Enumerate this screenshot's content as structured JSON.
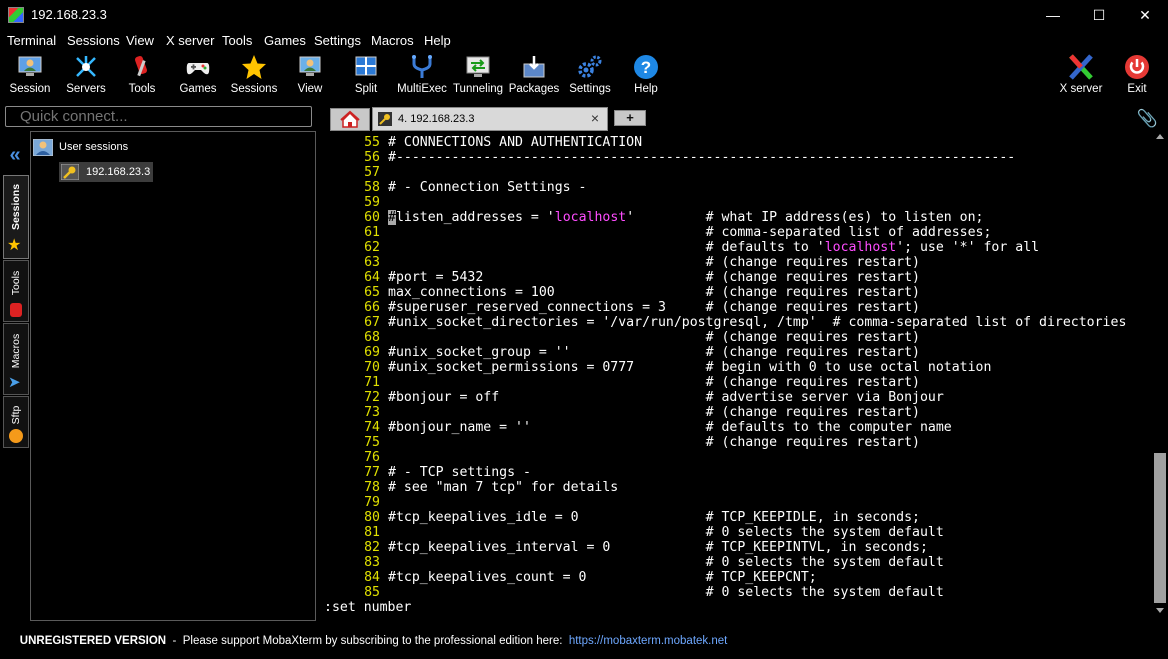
{
  "window": {
    "title": "192.168.23.3",
    "minimize": "—",
    "maximize": "☐",
    "close": "✕"
  },
  "menu": [
    "Terminal",
    "Sessions",
    "View",
    "X server",
    "Tools",
    "Games",
    "Settings",
    "Macros",
    "Help"
  ],
  "toolbar": {
    "items": [
      {
        "label": "Session",
        "icon": "session-icon"
      },
      {
        "label": "Servers",
        "icon": "servers-icon"
      },
      {
        "label": "Tools",
        "icon": "tools-icon"
      },
      {
        "label": "Games",
        "icon": "games-icon"
      },
      {
        "label": "Sessions",
        "icon": "star-icon"
      },
      {
        "label": "View",
        "icon": "view-icon"
      },
      {
        "label": "Split",
        "icon": "split-icon"
      },
      {
        "label": "MultiExec",
        "icon": "multiexec-icon"
      },
      {
        "label": "Tunneling",
        "icon": "tunneling-icon"
      },
      {
        "label": "Packages",
        "icon": "packages-icon"
      },
      {
        "label": "Settings",
        "icon": "gears-icon"
      },
      {
        "label": "Help",
        "icon": "help-icon"
      }
    ],
    "right": [
      {
        "label": "X server",
        "icon": "xserver-icon"
      },
      {
        "label": "Exit",
        "icon": "exit-icon"
      }
    ]
  },
  "quick_connect": {
    "placeholder": "Quick connect..."
  },
  "tabs": {
    "home_icon": "home-icon",
    "session_tab": "4. 192.168.23.3",
    "close": "×",
    "new_tab": "+"
  },
  "side_tabs": [
    "Sessions",
    "Tools",
    "Macros",
    "Sftp"
  ],
  "sessions_panel": {
    "root": "User sessions",
    "item": "192.168.23.3"
  },
  "terminal": {
    "lines": [
      {
        "n": "55",
        "t": "# CONNECTIONS AND AUTHENTICATION"
      },
      {
        "n": "56",
        "t": "#------------------------------------------------------------------------------"
      },
      {
        "n": "57",
        "t": ""
      },
      {
        "n": "58",
        "t": "# - Connection Settings -"
      },
      {
        "n": "59",
        "t": ""
      },
      {
        "n": "60",
        "pre": "#",
        "a": "listen_addresses = '",
        "s": "localhost",
        "b": "'         # what IP address(es) to listen on;"
      },
      {
        "n": "61",
        "t": "                                        # comma-separated list of addresses;"
      },
      {
        "n": "62",
        "a": "                                        # defaults to '",
        "s": "localhost",
        "b": "'; use '*' for all"
      },
      {
        "n": "63",
        "t": "                                        # (change requires restart)"
      },
      {
        "n": "64",
        "t": "#port = 5432                            # (change requires restart)"
      },
      {
        "n": "65",
        "t": "max_connections = 100                   # (change requires restart)"
      },
      {
        "n": "66",
        "t": "#superuser_reserved_connections = 3     # (change requires restart)"
      },
      {
        "n": "67",
        "t": "#unix_socket_directories = '/var/run/postgresql, /tmp'  # comma-separated list of directories"
      },
      {
        "n": "68",
        "t": "                                        # (change requires restart)"
      },
      {
        "n": "69",
        "t": "#unix_socket_group = ''                 # (change requires restart)"
      },
      {
        "n": "70",
        "t": "#unix_socket_permissions = 0777         # begin with 0 to use octal notation"
      },
      {
        "n": "71",
        "t": "                                        # (change requires restart)"
      },
      {
        "n": "72",
        "t": "#bonjour = off                          # advertise server via Bonjour"
      },
      {
        "n": "73",
        "t": "                                        # (change requires restart)"
      },
      {
        "n": "74",
        "t": "#bonjour_name = ''                      # defaults to the computer name"
      },
      {
        "n": "75",
        "t": "                                        # (change requires restart)"
      },
      {
        "n": "76",
        "t": ""
      },
      {
        "n": "77",
        "t": "# - TCP settings -"
      },
      {
        "n": "78",
        "t": "# see \"man 7 tcp\" for details"
      },
      {
        "n": "79",
        "t": ""
      },
      {
        "n": "80",
        "t": "#tcp_keepalives_idle = 0                # TCP_KEEPIDLE, in seconds;"
      },
      {
        "n": "81",
        "t": "                                        # 0 selects the system default"
      },
      {
        "n": "82",
        "t": "#tcp_keepalives_interval = 0            # TCP_KEEPINTVL, in seconds;"
      },
      {
        "n": "83",
        "t": "                                        # 0 selects the system default"
      },
      {
        "n": "84",
        "t": "#tcp_keepalives_count = 0               # TCP_KEEPCNT;"
      },
      {
        "n": "85",
        "t": "                                        # 0 selects the system default"
      }
    ],
    "command": ":set number"
  },
  "status": {
    "unregistered": "UNREGISTERED VERSION",
    "message": "  -  Please support MobaXterm by subscribing to the professional edition here:  ",
    "link": "https://mobaxterm.mobatek.net"
  },
  "colors": {
    "line_number": "#e0e000",
    "string": "#ff4cff",
    "link": "#6ea8ff"
  }
}
